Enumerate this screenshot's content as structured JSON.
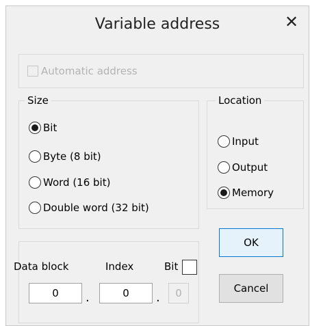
{
  "dialog": {
    "title": "Variable address",
    "close_glyph": "✕",
    "automatic_address": {
      "label": "Automatic address",
      "checked": false,
      "enabled": false
    }
  },
  "size": {
    "legend": "Size",
    "options": [
      {
        "label": "Bit",
        "selected": true
      },
      {
        "label": "Byte (8 bit)",
        "selected": false
      },
      {
        "label": "Word (16 bit)",
        "selected": false
      },
      {
        "label": "Double word (32 bit)",
        "selected": false
      }
    ]
  },
  "location": {
    "legend": "Location",
    "options": [
      {
        "label": "Input",
        "selected": false
      },
      {
        "label": "Output",
        "selected": false
      },
      {
        "label": "Memory",
        "selected": true
      }
    ]
  },
  "address": {
    "data_block_label": "Data block",
    "index_label": "Index",
    "bit_label": "Bit",
    "bit_checked": false,
    "data_block_value": "0",
    "index_value": "0",
    "bit_value": "0",
    "separator": "."
  },
  "buttons": {
    "ok": "OK",
    "cancel": "Cancel"
  },
  "icons": {
    "close": "close-icon",
    "radio_selected": "radio-dot-icon"
  }
}
